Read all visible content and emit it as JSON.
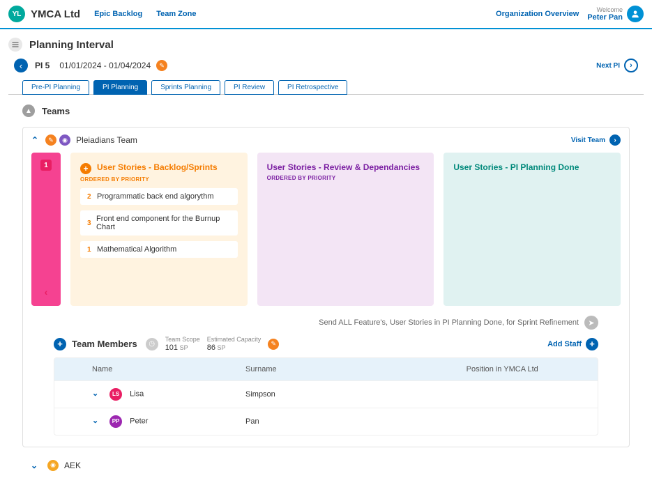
{
  "header": {
    "logo_text": "YL",
    "org_name": "YMCA Ltd",
    "nav": [
      "Epic Backlog",
      "Team Zone"
    ],
    "org_overview": "Organization Overview",
    "welcome_label": "Welcome",
    "user_name": "Peter Pan"
  },
  "page": {
    "title": "Planning Interval",
    "pi_label": "PI 5",
    "date_range": "01/01/2024 - 01/04/2024",
    "next_pi": "Next PI"
  },
  "tabs": [
    "Pre-PI Planning",
    "PI Planning",
    "Sprints Planning",
    "PI Review",
    "PI Retrospective"
  ],
  "active_tab_index": 1,
  "section_teams": "Teams",
  "team": {
    "name": "Pleiadians Team",
    "visit": "Visit Team",
    "rail_count": "1",
    "col1": {
      "title": "User Stories - Backlog/Sprints",
      "hint": "ORDERED BY PRIORITY",
      "stories": [
        {
          "num": "2",
          "text": "Programmatic back end algorythm"
        },
        {
          "num": "3",
          "text": "Front end component for the Burnup Chart"
        },
        {
          "num": "1",
          "text": "Mathematical Algorithm"
        }
      ]
    },
    "col2": {
      "title": "User Stories - Review & Dependancies",
      "hint": "ORDERED BY PRIORITY"
    },
    "col3": {
      "title": "User Stories - PI Planning Done"
    },
    "send_hint": "Send ALL Feature's, User Stories in PI Planning Done, for Sprint Refinement"
  },
  "members": {
    "title": "Team Members",
    "scope_label": "Team Scope",
    "scope_value": "101",
    "scope_unit": "SP",
    "cap_label": "Estimated Capacity",
    "cap_value": "86",
    "cap_unit": "SP",
    "add_staff": "Add Staff",
    "columns": [
      "Name",
      "Surname",
      "Position in YMCA Ltd"
    ],
    "rows": [
      {
        "initials": "LS",
        "name": "Lisa",
        "surname": "Simpson",
        "position": "",
        "avatar_class": "av-pink"
      },
      {
        "initials": "PP",
        "name": "Peter",
        "surname": "Pan",
        "position": "",
        "avatar_class": "av-purple"
      }
    ]
  },
  "collapsed_team": "AEK"
}
